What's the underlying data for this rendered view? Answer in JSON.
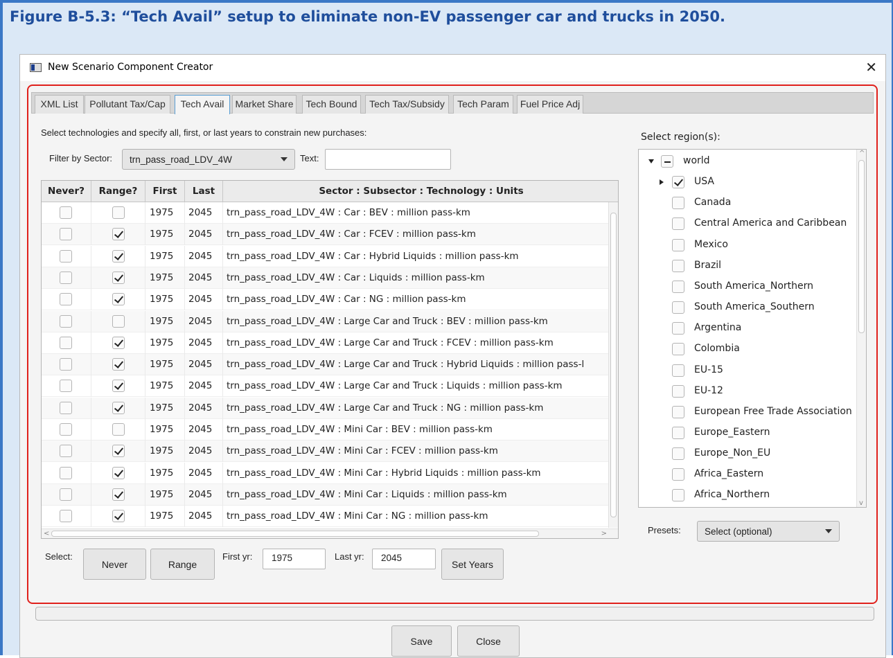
{
  "figure_title": "Figure B-5.3: “Tech Avail” setup to eliminate non-EV passenger car and trucks in 2050.",
  "window": {
    "title": "New Scenario Component Creator",
    "close_glyph": "✕"
  },
  "tabs": [
    "XML List",
    "Pollutant Tax/Cap",
    "Tech Avail",
    "Market Share",
    "Tech Bound",
    "Tech Tax/Subsidy",
    "Tech Param",
    "Fuel Price Adj"
  ],
  "active_tab": "Tech Avail",
  "instructions": "Select technologies and specify all, first, or last years to constrain new purchases:",
  "filter": {
    "label": "Filter by Sector:",
    "selected": "trn_pass_road_LDV_4W",
    "text_label": "Text:",
    "text_value": ""
  },
  "table": {
    "headers": [
      "Never?",
      "Range?",
      "First",
      "Last",
      "Sector : Subsector : Technology : Units"
    ],
    "rows": [
      {
        "never": false,
        "range": false,
        "first": "1975",
        "last": "2045",
        "tech": "trn_pass_road_LDV_4W : Car : BEV : million pass-km"
      },
      {
        "never": false,
        "range": true,
        "first": "1975",
        "last": "2045",
        "tech": "trn_pass_road_LDV_4W : Car : FCEV : million pass-km"
      },
      {
        "never": false,
        "range": true,
        "first": "1975",
        "last": "2045",
        "tech": "trn_pass_road_LDV_4W : Car : Hybrid Liquids : million pass-km"
      },
      {
        "never": false,
        "range": true,
        "first": "1975",
        "last": "2045",
        "tech": "trn_pass_road_LDV_4W : Car : Liquids : million pass-km"
      },
      {
        "never": false,
        "range": true,
        "first": "1975",
        "last": "2045",
        "tech": "trn_pass_road_LDV_4W : Car : NG : million pass-km"
      },
      {
        "never": false,
        "range": false,
        "first": "1975",
        "last": "2045",
        "tech": "trn_pass_road_LDV_4W : Large Car and Truck : BEV : million pass-km"
      },
      {
        "never": false,
        "range": true,
        "first": "1975",
        "last": "2045",
        "tech": "trn_pass_road_LDV_4W : Large Car and Truck : FCEV : million pass-km"
      },
      {
        "never": false,
        "range": true,
        "first": "1975",
        "last": "2045",
        "tech": "trn_pass_road_LDV_4W : Large Car and Truck : Hybrid Liquids : million pass-l"
      },
      {
        "never": false,
        "range": true,
        "first": "1975",
        "last": "2045",
        "tech": "trn_pass_road_LDV_4W : Large Car and Truck : Liquids : million pass-km"
      },
      {
        "never": false,
        "range": true,
        "first": "1975",
        "last": "2045",
        "tech": "trn_pass_road_LDV_4W : Large Car and Truck : NG : million pass-km"
      },
      {
        "never": false,
        "range": false,
        "first": "1975",
        "last": "2045",
        "tech": "trn_pass_road_LDV_4W : Mini Car : BEV : million pass-km"
      },
      {
        "never": false,
        "range": true,
        "first": "1975",
        "last": "2045",
        "tech": "trn_pass_road_LDV_4W : Mini Car : FCEV : million pass-km"
      },
      {
        "never": false,
        "range": true,
        "first": "1975",
        "last": "2045",
        "tech": "trn_pass_road_LDV_4W : Mini Car : Hybrid Liquids : million pass-km"
      },
      {
        "never": false,
        "range": true,
        "first": "1975",
        "last": "2045",
        "tech": "trn_pass_road_LDV_4W : Mini Car : Liquids : million pass-km"
      },
      {
        "never": false,
        "range": true,
        "first": "1975",
        "last": "2045",
        "tech": "trn_pass_road_LDV_4W : Mini Car : NG : million pass-km"
      }
    ]
  },
  "bottom_controls": {
    "select_label": "Select:",
    "never_button": "Never",
    "range_button": "Range",
    "first_yr_label": "First yr:",
    "first_yr_value": "1975",
    "last_yr_label": "Last yr:",
    "last_yr_value": "2045",
    "set_years_button": "Set Years"
  },
  "regions": {
    "label": "Select region(s):",
    "items": [
      {
        "name": "world",
        "level": 0,
        "state": "partial",
        "expander": "expanded"
      },
      {
        "name": "USA",
        "level": 1,
        "state": "checked",
        "expander": "collapsed"
      },
      {
        "name": "Canada",
        "level": 1,
        "state": "unchecked",
        "expander": "none"
      },
      {
        "name": "Central America and Caribbean",
        "level": 1,
        "state": "unchecked",
        "expander": "none"
      },
      {
        "name": "Mexico",
        "level": 1,
        "state": "unchecked",
        "expander": "none"
      },
      {
        "name": "Brazil",
        "level": 1,
        "state": "unchecked",
        "expander": "none"
      },
      {
        "name": "South America_Northern",
        "level": 1,
        "state": "unchecked",
        "expander": "none"
      },
      {
        "name": "South America_Southern",
        "level": 1,
        "state": "unchecked",
        "expander": "none"
      },
      {
        "name": "Argentina",
        "level": 1,
        "state": "unchecked",
        "expander": "none"
      },
      {
        "name": "Colombia",
        "level": 1,
        "state": "unchecked",
        "expander": "none"
      },
      {
        "name": "EU-15",
        "level": 1,
        "state": "unchecked",
        "expander": "none"
      },
      {
        "name": "EU-12",
        "level": 1,
        "state": "unchecked",
        "expander": "none"
      },
      {
        "name": "European Free Trade Association",
        "level": 1,
        "state": "unchecked",
        "expander": "none"
      },
      {
        "name": "Europe_Eastern",
        "level": 1,
        "state": "unchecked",
        "expander": "none"
      },
      {
        "name": "Europe_Non_EU",
        "level": 1,
        "state": "unchecked",
        "expander": "none"
      },
      {
        "name": "Africa_Eastern",
        "level": 1,
        "state": "unchecked",
        "expander": "none"
      },
      {
        "name": "Africa_Northern",
        "level": 1,
        "state": "unchecked",
        "expander": "none"
      }
    ],
    "presets_label": "Presets:",
    "presets_selected": "Select (optional)"
  },
  "footer": {
    "save_button": "Save",
    "close_button": "Close",
    "progress": 0
  },
  "colors": {
    "accent_blue": "#1f4e9c",
    "highlight_red": "#e0201b",
    "figure_bg": "#dbe8f6"
  }
}
